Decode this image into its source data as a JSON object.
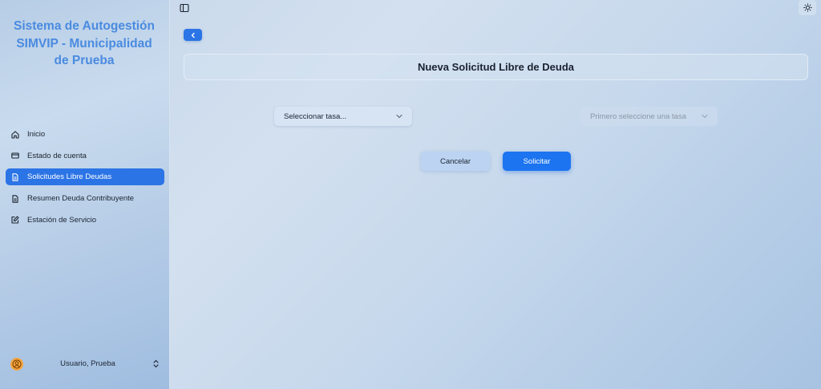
{
  "sidebar": {
    "title": "Sistema de Autogestión SIMVIP - Municipalidad de Prueba",
    "items": [
      {
        "label": "Inicio",
        "icon": "home-icon"
      },
      {
        "label": "Estado de cuenta",
        "icon": "credit-card-icon"
      },
      {
        "label": "Solicitudes Libre Deudas",
        "icon": "document-icon",
        "active": true
      },
      {
        "label": "Resumen Deuda Contribuyente",
        "icon": "document-icon"
      },
      {
        "label": "Estación de Servicio",
        "icon": "edit-icon"
      }
    ],
    "user": {
      "name": "Usuario, Prueba",
      "icon": "user-circle-icon"
    }
  },
  "header": {
    "toggle_icon": "sidebar-toggle-icon",
    "theme_icon": "sun-icon"
  },
  "main": {
    "back_icon": "chevron-left-icon",
    "title": "Nueva Solicitud Libre de Deuda",
    "select_tasa": {
      "placeholder": "Seleccionar tasa..."
    },
    "select_second": {
      "placeholder": "Primero seleccione una tasa",
      "disabled": true
    },
    "cancel_label": "Cancelar",
    "submit_label": "Solicitar"
  },
  "colors": {
    "accent": "#2b74e6",
    "title_blue": "#4a8be0",
    "primary_button": "#1c74f0",
    "avatar": "#f3a540"
  }
}
